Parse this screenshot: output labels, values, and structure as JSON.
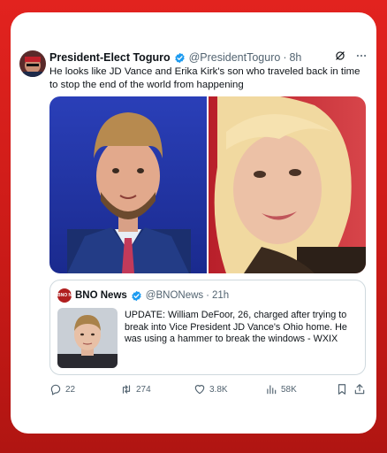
{
  "tweet": {
    "author_name": "President-Elect Toguro",
    "author_handle": "@PresidentToguro",
    "separator": "·",
    "time": "8h",
    "text": "He looks like JD Vance and Erika Kirk's son who traveled back in time to stop the end of the world from happening"
  },
  "quote": {
    "logo_text": "BNO NEWS",
    "author_name": "BNO News",
    "author_handle": "@BNONews",
    "separator": "·",
    "time": "21h",
    "text": "UPDATE: William DeFoor, 26, charged after trying to break into Vice President JD Vance's Ohio home. He was using a hammer to break the windows - WXIX"
  },
  "actions": {
    "replies": "22",
    "reposts": "274",
    "likes": "3.8K",
    "views": "58K"
  },
  "colors": {
    "background": "#e2231f",
    "verified": "#1d9bf0",
    "text_primary": "#0f1419",
    "text_secondary": "#536471"
  },
  "icons": {
    "verified": "verified-badge-icon",
    "grok": "grok-icon",
    "more": "more-icon",
    "reply": "reply-icon",
    "repost": "repost-icon",
    "like": "heart-icon",
    "views": "views-icon",
    "bookmark": "bookmark-icon",
    "share": "share-icon"
  }
}
